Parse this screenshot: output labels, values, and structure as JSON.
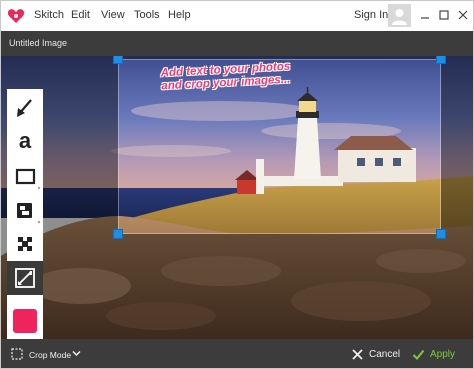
{
  "app": {
    "menu": [
      "Skitch",
      "Edit",
      "View",
      "Tools",
      "Help"
    ],
    "sign_in": "Sign In",
    "brand_color": "#e8295c"
  },
  "document": {
    "title": "Untitled Image"
  },
  "canvas": {
    "overlay_text_line1": "Add text to your photos",
    "overlay_text_line2": "and crop your images..."
  },
  "tools": [
    {
      "name": "arrow-icon"
    },
    {
      "name": "text-icon",
      "glyph": "a"
    },
    {
      "name": "rectangle-icon"
    },
    {
      "name": "stamp-icon"
    },
    {
      "name": "pixelate-icon"
    },
    {
      "name": "crop-resize-icon",
      "active": true
    }
  ],
  "color": {
    "current": "#f0245c"
  },
  "bottom": {
    "crop_mode_label": "Crop Mode",
    "cancel_label": "Cancel",
    "apply_label": "Apply",
    "apply_color": "#7ec843"
  }
}
